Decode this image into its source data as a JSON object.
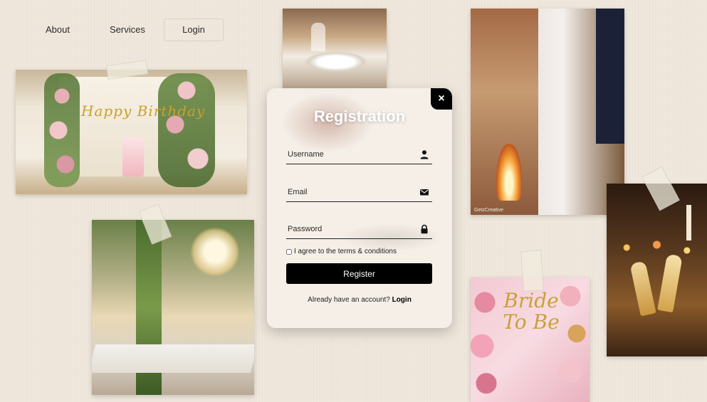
{
  "nav": {
    "about": "About",
    "services": "Services",
    "login": "Login"
  },
  "photos": {
    "birthday_text": "Happy Birthday",
    "wedding_watermark": "GetzCreative",
    "bride_text": "Bride To Be"
  },
  "modal": {
    "title": "Registration",
    "close_icon": "×",
    "username_placeholder": "Username",
    "email_placeholder": "Email",
    "password_placeholder": "Password",
    "terms_label": "I agree to the terms & conditions",
    "register_label": "Register",
    "prompt_text": "Already have an account?",
    "prompt_link": "Login"
  },
  "icons": {
    "username": "user-icon",
    "email": "envelope-icon",
    "password": "lock-icon"
  },
  "colors": {
    "background": "#efe7dc",
    "button": "#000000",
    "title": "#ffffff"
  }
}
